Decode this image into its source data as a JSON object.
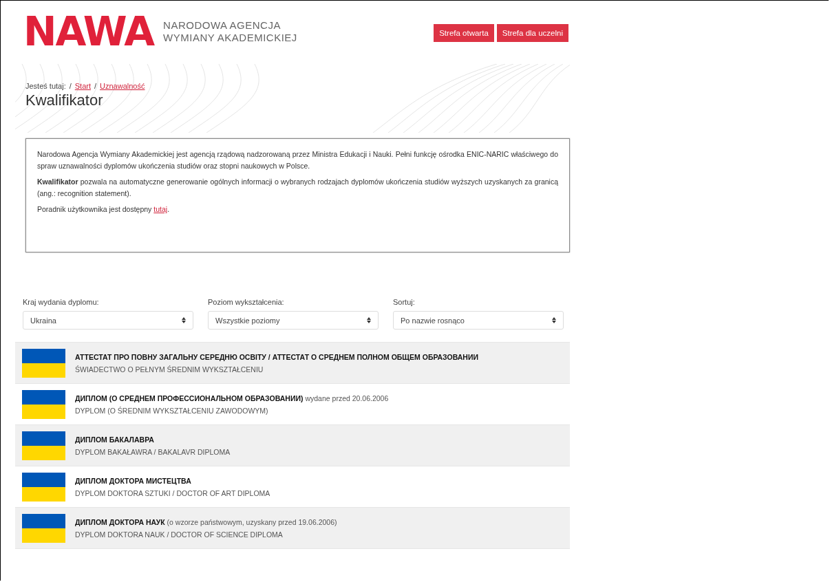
{
  "header": {
    "logo": "NAWA",
    "agency_name": [
      "NARODOWA AGENCJA",
      "WYMIANY AKADEMICKIEJ"
    ],
    "buttons": [
      "Strefa otwarta",
      "Strefa dla uczelni"
    ]
  },
  "breadcrumb": {
    "label": "Jesteś tutaj:",
    "separator": "/",
    "links": [
      "Start",
      "Uznawalność"
    ]
  },
  "page_title": "Kwalifikator",
  "info": {
    "paragraphs": [
      "Narodowa Agencja Wymiany Akademickiej jest agencją rządową nadzorowaną przez Ministra Edukacji i Nauki. Pełni funkcję ośrodka ENIC-NARIC właściwego do spraw uznawalności dyplomów ukończenia studiów oraz stopni naukowych w Polsce.",
      "**Kwalifikator** pozwala na automatyczne generowanie ogólnych informacji o wybranych rodzajach dyplomów ukończenia studiów wyższych uzyskanych za granicą (ang.: recognition statement)."
    ],
    "guide_text": "Poradnik użytkownika jest dostępny ",
    "guide_link": "tutaj",
    "guide_end": "."
  },
  "filters": [
    {
      "label": "Kraj wydania dyplomu:",
      "value": "Ukraina"
    },
    {
      "label": "Poziom wykształcenia:",
      "value": "Wszystkie poziomy"
    },
    {
      "label": "Sortuj:",
      "value": "Po nazwie rosnąco"
    }
  ],
  "diplomas": [
    {
      "title": "АТТЕСТАТ ПРО ПОВНУ ЗАГАЛЬНУ СЕРЕДНЮ ОСВІТУ / АТТЕСТАТ О СРЕДНЕМ ПОЛНОМ ОБЩЕМ ОБРАЗОВАНИИ",
      "subtitle": "ŚWIADECTWO O PEŁNYM ŚREDNIM WYKSZTAŁCENIU"
    },
    {
      "title": "ДИПЛОМ (О СРЕДНЕМ ПРОФЕССИОНАЛЬНОМ ОБРАЗОВАНИИ)",
      "note": "wydane przed 20.06.2006",
      "subtitle": "DYPLOM (O ŚREDNIM WYKSZTAŁCENIU ZAWODOWYM)"
    },
    {
      "title": "ДИПЛОМ БАКАЛАВРА",
      "subtitle": "DYPLOM BAKAŁAWRA / BAKALAVR DIPLOMA"
    },
    {
      "title": "ДИПЛОМ ДОКТОРА МИСТЕЦТВА",
      "subtitle": "DYPLOM DOKTORA SZTUKI / DOCTOR OF ART DIPLOMA"
    },
    {
      "title": "ДИПЛОМ ДОКТОРА НАУК",
      "note": "(o wzorze państwowym, uzyskany przed 19.06.2006)",
      "subtitle": "DYPLOM DOKTORA NAUK / DOCTOR OF SCIENCE DIPLOMA"
    }
  ]
}
